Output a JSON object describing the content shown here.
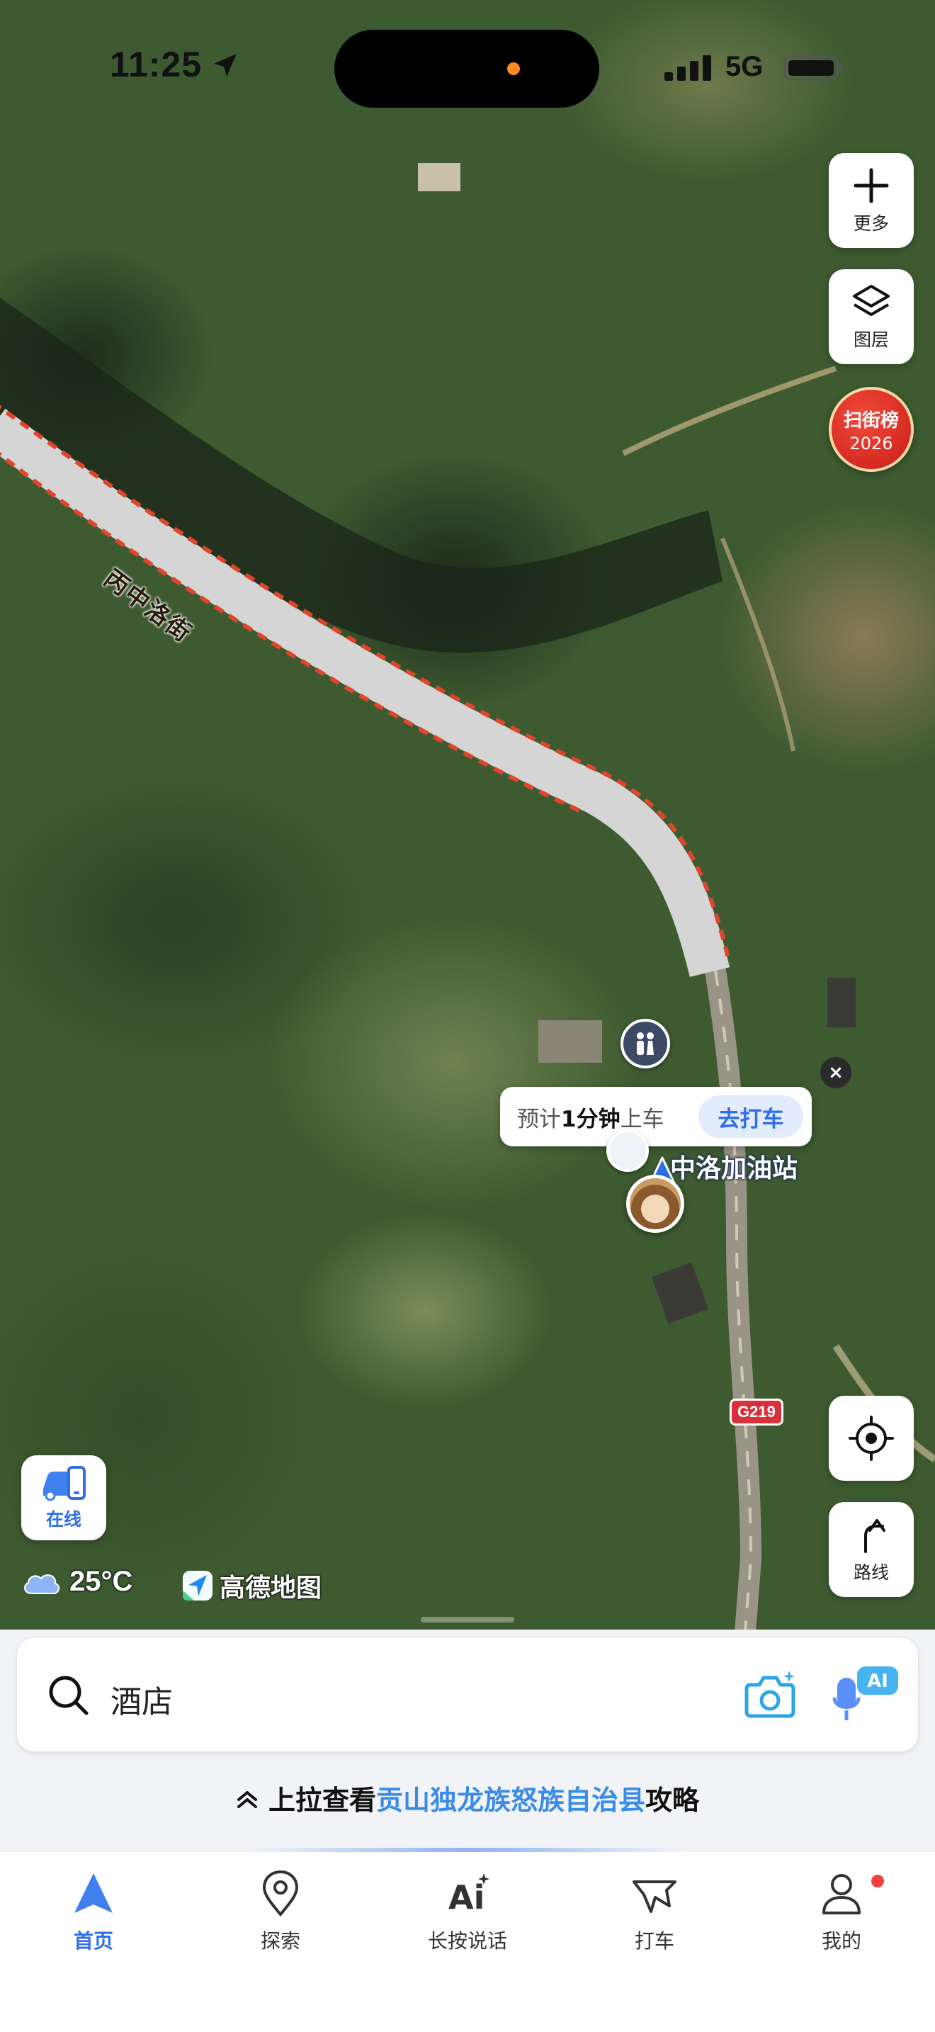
{
  "status_bar": {
    "time": "11:25",
    "network": "5G"
  },
  "map": {
    "road_name": "丙中洛街",
    "route_shield": "G219",
    "station_name": "中洛加油站",
    "taxi_prompt": {
      "prefix": "预计",
      "eta": "1分钟",
      "suffix": "上车",
      "button": "去打车"
    },
    "close_symbol": "×"
  },
  "controls": {
    "more_label": "更多",
    "layers_label": "图层",
    "scan_badge_line1": "扫街榜",
    "scan_badge_line2": "2026",
    "route_label": "路线",
    "online_label": "在线"
  },
  "overlay": {
    "temperature": "25°C",
    "brand": "高德地图"
  },
  "search": {
    "value": "酒店",
    "ai_badge": "AI"
  },
  "strategy": {
    "prefix": "上拉查看",
    "place": "贡山独龙族怒族自治县",
    "suffix": "攻略"
  },
  "tabs": [
    {
      "label": "首页",
      "icon": "navigation-arrow-icon",
      "active": true
    },
    {
      "label": "探索",
      "icon": "location-pin-icon",
      "active": false
    },
    {
      "label": "长按说话",
      "icon": "ai-icon",
      "active": false
    },
    {
      "label": "打车",
      "icon": "taxi-flag-icon",
      "active": false
    },
    {
      "label": "我的",
      "icon": "person-icon",
      "active": false
    }
  ],
  "colors": {
    "accent": "#2f6ee8",
    "route_dash": "#e0452b",
    "highlight_text": "#3b8be8",
    "notification": "#f0413b"
  }
}
